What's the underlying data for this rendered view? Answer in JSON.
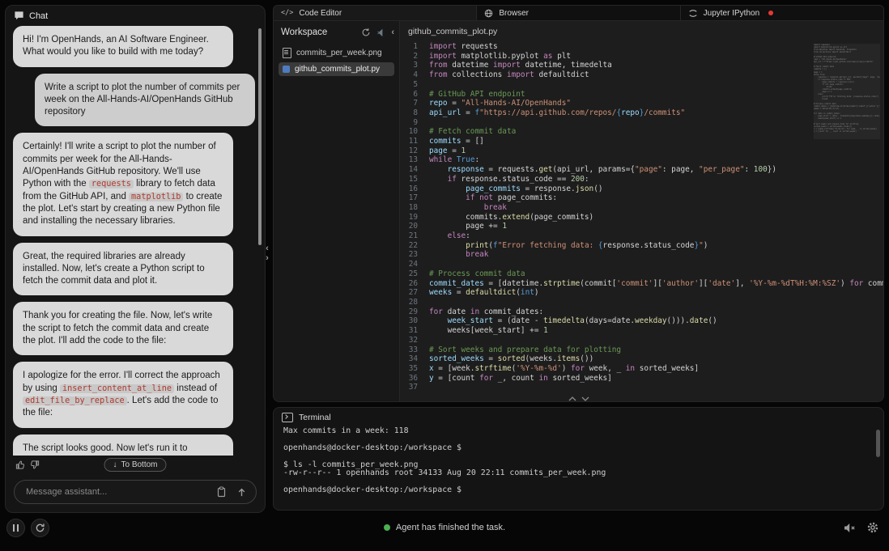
{
  "colors": {
    "status_green": "#4caf50",
    "badge_red": "#e53935",
    "python_blue": "#4e7cbf"
  },
  "icons": {
    "handle_left": "‹",
    "handle_right": "›",
    "collapse_left": "‹",
    "down_arrow": "↓"
  },
  "chat": {
    "title": "Chat",
    "input_placeholder": "Message assistant...",
    "to_bottom_label": "To Bottom",
    "messages": [
      {
        "role": "assistant",
        "parts": [
          {
            "t": "text",
            "v": "Hi! I'm OpenHands, an AI Software Engineer. What would you like to build with me today?"
          }
        ]
      },
      {
        "role": "user",
        "parts": [
          {
            "t": "text",
            "v": "Write a script to plot the number of commits per week on the All-Hands-AI/OpenHands GitHub repository"
          }
        ]
      },
      {
        "role": "assistant",
        "parts": [
          {
            "t": "text",
            "v": "Certainly! I'll write a script to plot the number of commits per week for the All-Hands-AI/OpenHands GitHub repository. We'll use Python with the "
          },
          {
            "t": "code",
            "v": "requests"
          },
          {
            "t": "text",
            "v": " library to fetch data from the GitHub API, and "
          },
          {
            "t": "code",
            "v": "matplotlib"
          },
          {
            "t": "text",
            "v": " to create the plot. Let's start by creating a new Python file and installing the necessary libraries."
          }
        ]
      },
      {
        "role": "assistant",
        "parts": [
          {
            "t": "text",
            "v": "Great, the required libraries are already installed. Now, let's create a Python script to fetch the commit data and plot it."
          }
        ]
      },
      {
        "role": "assistant",
        "parts": [
          {
            "t": "text",
            "v": "Thank you for creating the file. Now, let's write the script to fetch the commit data and create the plot. I'll add the code to the file:"
          }
        ]
      },
      {
        "role": "assistant",
        "parts": [
          {
            "t": "text",
            "v": "I apologize for the error. I'll correct the approach by using "
          },
          {
            "t": "code",
            "v": "insert_content_at_line"
          },
          {
            "t": "text",
            "v": " instead of "
          },
          {
            "t": "code",
            "v": "edit_file_by_replace"
          },
          {
            "t": "text",
            "v": ". Let's add the code to the file:"
          }
        ]
      },
      {
        "role": "assistant",
        "parts": [
          {
            "t": "text",
            "v": "The script looks good. Now let's run it to generate the plot and get the statistics:"
          }
        ]
      }
    ]
  },
  "tabs": [
    {
      "label": "Code Editor"
    },
    {
      "label": "Browser"
    },
    {
      "label": "Jupyter IPython"
    }
  ],
  "workspace": {
    "title": "Workspace",
    "files": [
      {
        "name": "commits_per_week.png"
      },
      {
        "name": "github_commits_plot.py"
      }
    ]
  },
  "editor": {
    "filename": "github_commits_plot.py",
    "lines": [
      [
        [
          "k",
          "import"
        ],
        [
          "p",
          " requests"
        ]
      ],
      [
        [
          "k",
          "import"
        ],
        [
          "p",
          " matplotlib.pyplot "
        ],
        [
          "k",
          "as"
        ],
        [
          "p",
          " plt"
        ]
      ],
      [
        [
          "k",
          "from"
        ],
        [
          "p",
          " datetime "
        ],
        [
          "k",
          "import"
        ],
        [
          "p",
          " datetime, timedelta"
        ]
      ],
      [
        [
          "k",
          "from"
        ],
        [
          "p",
          " collections "
        ],
        [
          "k",
          "import"
        ],
        [
          "p",
          " defaultdict"
        ]
      ],
      [],
      [
        [
          "c",
          "# GitHub API endpoint"
        ]
      ],
      [
        [
          "v",
          "repo"
        ],
        [
          "p",
          " = "
        ],
        [
          "s",
          "\"All-Hands-AI/OpenHands\""
        ]
      ],
      [
        [
          "v",
          "api_url"
        ],
        [
          "p",
          " = "
        ],
        [
          "b",
          "f"
        ],
        [
          "s",
          "\"https://api.github.com/repos/"
        ],
        [
          "b",
          "{"
        ],
        [
          "v",
          "repo"
        ],
        [
          "b",
          "}"
        ],
        [
          "s",
          "/commits\""
        ]
      ],
      [],
      [
        [
          "c",
          "# Fetch commit data"
        ]
      ],
      [
        [
          "v",
          "commits"
        ],
        [
          "p",
          " = []"
        ]
      ],
      [
        [
          "v",
          "page"
        ],
        [
          "p",
          " = "
        ],
        [
          "n",
          "1"
        ]
      ],
      [
        [
          "k",
          "while"
        ],
        [
          "p",
          " "
        ],
        [
          "b",
          "True"
        ],
        [
          "p",
          ":"
        ]
      ],
      [
        [
          "p",
          "    "
        ],
        [
          "v",
          "response"
        ],
        [
          "p",
          " = requests."
        ],
        [
          "f",
          "get"
        ],
        [
          "p",
          "(api_url, params={"
        ],
        [
          "s",
          "\"page\""
        ],
        [
          "p",
          ": page, "
        ],
        [
          "s",
          "\"per_page\""
        ],
        [
          "p",
          ": "
        ],
        [
          "n",
          "100"
        ],
        [
          "p",
          "})"
        ]
      ],
      [
        [
          "p",
          "    "
        ],
        [
          "k",
          "if"
        ],
        [
          "p",
          " response.status_code == "
        ],
        [
          "n",
          "200"
        ],
        [
          "p",
          ":"
        ]
      ],
      [
        [
          "p",
          "        "
        ],
        [
          "v",
          "page_commits"
        ],
        [
          "p",
          " = response."
        ],
        [
          "f",
          "json"
        ],
        [
          "p",
          "()"
        ]
      ],
      [
        [
          "p",
          "        "
        ],
        [
          "k",
          "if"
        ],
        [
          "p",
          " "
        ],
        [
          "k",
          "not"
        ],
        [
          "p",
          " page_commits:"
        ]
      ],
      [
        [
          "p",
          "            "
        ],
        [
          "k",
          "break"
        ]
      ],
      [
        [
          "p",
          "        commits."
        ],
        [
          "f",
          "extend"
        ],
        [
          "p",
          "(page_commits)"
        ]
      ],
      [
        [
          "p",
          "        page += "
        ],
        [
          "n",
          "1"
        ]
      ],
      [
        [
          "p",
          "    "
        ],
        [
          "k",
          "else"
        ],
        [
          "p",
          ":"
        ]
      ],
      [
        [
          "p",
          "        "
        ],
        [
          "f",
          "print"
        ],
        [
          "p",
          "("
        ],
        [
          "b",
          "f"
        ],
        [
          "s",
          "\"Error fetching data: "
        ],
        [
          "b",
          "{"
        ],
        [
          "p",
          "response.status_code"
        ],
        [
          "b",
          "}"
        ],
        [
          "s",
          "\""
        ],
        [
          "p",
          ")"
        ]
      ],
      [
        [
          "p",
          "        "
        ],
        [
          "k",
          "break"
        ]
      ],
      [],
      [
        [
          "c",
          "# Process commit data"
        ]
      ],
      [
        [
          "v",
          "commit_dates"
        ],
        [
          "p",
          " = [datetime."
        ],
        [
          "f",
          "strptime"
        ],
        [
          "p",
          "(commit["
        ],
        [
          "s",
          "'commit'"
        ],
        [
          "p",
          "]["
        ],
        [
          "s",
          "'author'"
        ],
        [
          "p",
          "]["
        ],
        [
          "s",
          "'date'"
        ],
        [
          "p",
          "], "
        ],
        [
          "s",
          "'%Y-%m-%dT%H:%M:%SZ'"
        ],
        [
          "p",
          ") "
        ],
        [
          "k",
          "for"
        ],
        [
          "p",
          " commit "
        ],
        [
          "k",
          "in"
        ],
        [
          "p",
          " commits]"
        ]
      ],
      [
        [
          "v",
          "weeks"
        ],
        [
          "p",
          " = "
        ],
        [
          "f",
          "defaultdict"
        ],
        [
          "p",
          "("
        ],
        [
          "b",
          "int"
        ],
        [
          "p",
          ")"
        ]
      ],
      [],
      [
        [
          "k",
          "for"
        ],
        [
          "p",
          " date "
        ],
        [
          "k",
          "in"
        ],
        [
          "p",
          " commit_dates:"
        ]
      ],
      [
        [
          "p",
          "    "
        ],
        [
          "v",
          "week_start"
        ],
        [
          "p",
          " = (date - "
        ],
        [
          "f",
          "timedelta"
        ],
        [
          "p",
          "(days=date."
        ],
        [
          "f",
          "weekday"
        ],
        [
          "p",
          "()))."
        ],
        [
          "f",
          "date"
        ],
        [
          "p",
          "()"
        ]
      ],
      [
        [
          "p",
          "    weeks[week_start] += "
        ],
        [
          "n",
          "1"
        ]
      ],
      [],
      [
        [
          "c",
          "# Sort weeks and prepare data for plotting"
        ]
      ],
      [
        [
          "v",
          "sorted_weeks"
        ],
        [
          "p",
          " = "
        ],
        [
          "f",
          "sorted"
        ],
        [
          "p",
          "(weeks."
        ],
        [
          "f",
          "items"
        ],
        [
          "p",
          "())"
        ]
      ],
      [
        [
          "v",
          "x"
        ],
        [
          "p",
          " = [week."
        ],
        [
          "f",
          "strftime"
        ],
        [
          "p",
          "("
        ],
        [
          "s",
          "'%Y-%m-%d'"
        ],
        [
          "p",
          ") "
        ],
        [
          "k",
          "for"
        ],
        [
          "p",
          " week, _ "
        ],
        [
          "k",
          "in"
        ],
        [
          "p",
          " sorted_weeks]"
        ]
      ],
      [
        [
          "v",
          "y"
        ],
        [
          "p",
          " = [count "
        ],
        [
          "k",
          "for"
        ],
        [
          "p",
          " _, count "
        ],
        [
          "k",
          "in"
        ],
        [
          "p",
          " sorted_weeks]"
        ]
      ],
      []
    ]
  },
  "terminal": {
    "title": "Terminal",
    "lines": [
      "Max commits in a week: 118",
      "",
      "openhands@docker-desktop:/workspace $",
      "",
      "$ ls -l commits_per_week.png",
      "-rw-r--r-- 1 openhands root 34133 Aug 20 22:11 commits_per_week.png",
      "",
      "openhands@docker-desktop:/workspace $"
    ]
  },
  "status": {
    "message": "Agent has finished the task."
  }
}
